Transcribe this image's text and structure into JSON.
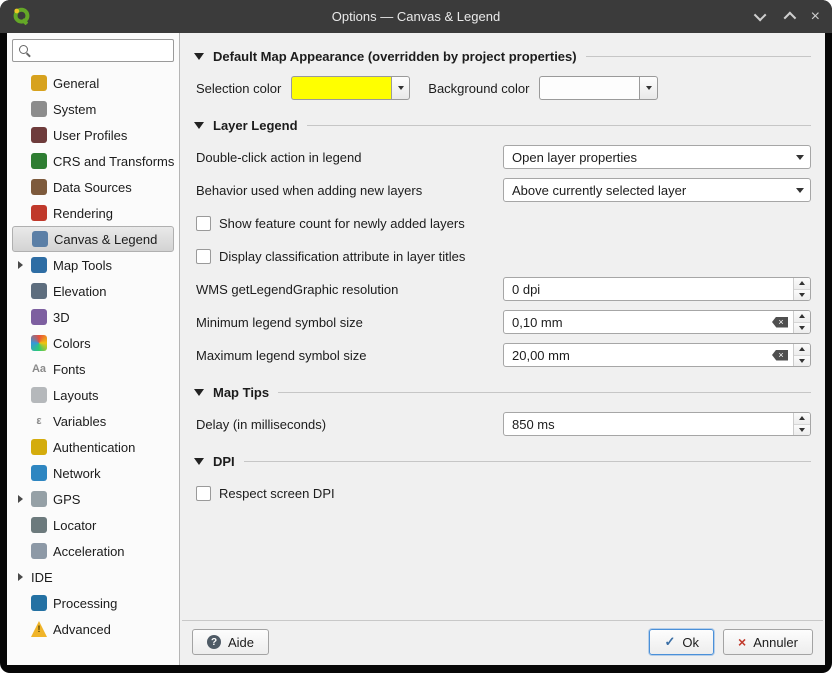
{
  "window": {
    "title": "Options — Canvas & Legend"
  },
  "sidebar": {
    "search_placeholder": "",
    "items": [
      {
        "label": "General",
        "icon": "wrench-icon",
        "icon_type": "chip",
        "color": "#d7a21e"
      },
      {
        "label": "System",
        "icon": "gear-icon",
        "icon_type": "chip",
        "color": "#8c8c8c"
      },
      {
        "label": "User Profiles",
        "icon": "user-icon",
        "icon_type": "chip",
        "color": "#6e3b3b"
      },
      {
        "label": "CRS and Transforms",
        "icon": "globe-crs-icon",
        "icon_type": "chip",
        "color": "#2e7d32"
      },
      {
        "label": "Data Sources",
        "icon": "layers-icon",
        "icon_type": "chip",
        "color": "#7d5a3c"
      },
      {
        "label": "Rendering",
        "icon": "paintbrush-icon",
        "icon_type": "chip",
        "color": "#c0392b"
      },
      {
        "label": "Canvas & Legend",
        "icon": "canvas-icon",
        "icon_type": "chip",
        "color": "#5b7fa6",
        "selected": true
      },
      {
        "label": "Map Tools",
        "icon": "map-tools-icon",
        "icon_type": "chip",
        "color": "#2e6da4",
        "expandable": true
      },
      {
        "label": "Elevation",
        "icon": "mountain-icon",
        "icon_type": "chip",
        "color": "#5d6d7e"
      },
      {
        "label": "3D",
        "icon": "cube-3d-icon",
        "icon_type": "chip",
        "color": "#7d5fa0"
      },
      {
        "label": "Colors",
        "icon": "palette-icon",
        "icon_type": "chip",
        "color": "conic-gradient(#e74c3c,#f1c40f,#2ecc71,#3498db,#e74c3c)"
      },
      {
        "label": "Fonts",
        "icon": "fonts-icon",
        "icon_type": "text",
        "glyph": "Aa"
      },
      {
        "label": "Layouts",
        "icon": "layout-icon",
        "icon_type": "chip",
        "color": "#b5b8bb"
      },
      {
        "label": "Variables",
        "icon": "epsilon-icon",
        "icon_type": "text",
        "glyph": "ε"
      },
      {
        "label": "Authentication",
        "icon": "lock-icon",
        "icon_type": "chip",
        "color": "#d4ac0d"
      },
      {
        "label": "Network",
        "icon": "network-globe-icon",
        "icon_type": "chip",
        "color": "#2e86c1"
      },
      {
        "label": "GPS",
        "icon": "satellite-icon",
        "icon_type": "chip",
        "color": "#95a0a6",
        "expandable": true
      },
      {
        "label": "Locator",
        "icon": "magnifier-icon",
        "icon_type": "chip",
        "color": "#6c7a7d"
      },
      {
        "label": "Acceleration",
        "icon": "chip-icon",
        "icon_type": "chip",
        "color": "#8d99a6"
      },
      {
        "label": "IDE",
        "icon": "none",
        "icon_type": "none",
        "expandable": true
      },
      {
        "label": "Processing",
        "icon": "processing-gear-icon",
        "icon_type": "chip",
        "color": "#2471a3"
      },
      {
        "label": "Advanced",
        "icon": "warning-icon",
        "icon_type": "chip",
        "color": "#f0b429",
        "glyph": "!",
        "glyph_color": "#4a3b00",
        "clip": "polygon(50% 0, 100% 100%, 0 100%)"
      }
    ]
  },
  "sections": {
    "appearance": {
      "title": "Default Map Appearance (overridden by project properties)",
      "selection_label": "Selection color",
      "selection_color": "#ffff00",
      "background_label": "Background color",
      "background_color": "#fdfdfd"
    },
    "legend": {
      "title": "Layer Legend",
      "double_click_label": "Double-click action in legend",
      "double_click_value": "Open layer properties",
      "add_behavior_label": "Behavior used when adding new layers",
      "add_behavior_value": "Above currently selected layer",
      "feature_count_label": "Show feature count for newly added layers",
      "feature_count_checked": false,
      "classification_label": "Display classification attribute in layer titles",
      "classification_checked": false,
      "wms_label": "WMS getLegendGraphic resolution",
      "wms_value": "0 dpi",
      "min_symbol_label": "Minimum legend symbol size",
      "min_symbol_value": "0,10 mm",
      "max_symbol_label": "Maximum legend symbol size",
      "max_symbol_value": "20,00 mm"
    },
    "maptips": {
      "title": "Map Tips",
      "delay_label": "Delay (in milliseconds)",
      "delay_value": "850 ms"
    },
    "dpi": {
      "title": "DPI",
      "respect_label": "Respect screen DPI",
      "respect_checked": false
    }
  },
  "footer": {
    "help_label": "Aide",
    "ok_label": "Ok",
    "cancel_label": "Annuler"
  }
}
